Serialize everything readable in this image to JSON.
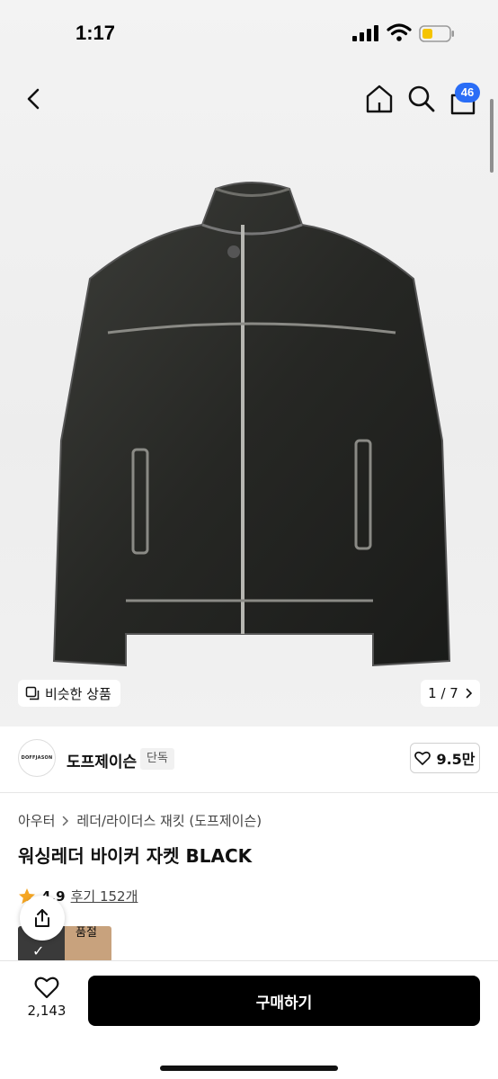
{
  "status_bar": {
    "time": "1:17"
  },
  "nav": {
    "cart_count": "46"
  },
  "gallery": {
    "similar_label": "비슷한 상품",
    "pager": "1 / 7"
  },
  "brand": {
    "logo_text": "DOFFJASON",
    "name": "도프제이슨",
    "exclusive_tag": "단독",
    "likes": "9.5만"
  },
  "product": {
    "breadcrumb": [
      "아우터",
      "레더/라이더스 재킷 (도프제이슨)"
    ],
    "title": "워싱레더 바이커 자켓 BLACK",
    "rating": "4.9",
    "reviews": "후기 152개",
    "soldout_label": "품절"
  },
  "bottom": {
    "wish_count": "2,143",
    "buy_label": "구매하기"
  },
  "colors": {
    "accent": "#2a6df6",
    "star": "#f5a623",
    "buy_bg": "#000000"
  }
}
